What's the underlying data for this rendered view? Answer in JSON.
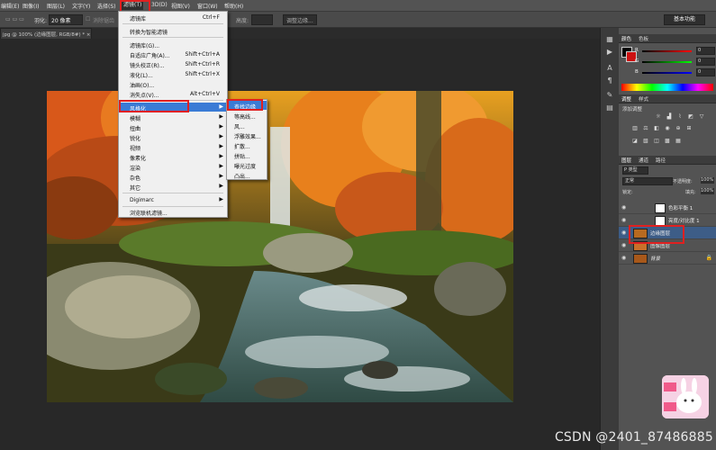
{
  "menubar": {
    "items": [
      {
        "label": "编辑(E)"
      },
      {
        "label": "图像(I)"
      },
      {
        "label": "图层(L)"
      },
      {
        "label": "文字(Y)"
      },
      {
        "label": "选择(S)"
      },
      {
        "label": "滤镜(T)"
      },
      {
        "label": "3D(D)"
      },
      {
        "label": "视图(V)"
      },
      {
        "label": "窗口(W)"
      },
      {
        "label": "帮助(H)"
      }
    ]
  },
  "options_bar": {
    "feather_label": "羽化:",
    "feather_value": "20 像素",
    "antialias_label": "消除锯齿",
    "height_label": "高度:",
    "refine_edge_button": "调整边缘...",
    "workspace_preset": "基本功能"
  },
  "document_tab": {
    "title": "jpg @ 100% (边缘图层, RGB/8#) * ×"
  },
  "filter_menu": {
    "items": [
      {
        "label": "滤镜库",
        "shortcut": "Ctrl+F"
      },
      {
        "label": "转换为智能滤镜",
        "shortcut": ""
      },
      {
        "label": "滤镜库(G)...",
        "shortcut": ""
      },
      {
        "label": "自适应广角(A)...",
        "shortcut": "Shift+Ctrl+A"
      },
      {
        "label": "镜头校正(R)...",
        "shortcut": "Shift+Ctrl+R"
      },
      {
        "label": "液化(L)...",
        "shortcut": "Shift+Ctrl+X"
      },
      {
        "label": "油画(O)...",
        "shortcut": ""
      },
      {
        "label": "消失点(V)...",
        "shortcut": "Alt+Ctrl+V"
      },
      {
        "label": "风格化",
        "shortcut": ""
      },
      {
        "label": "模糊",
        "shortcut": ""
      },
      {
        "label": "扭曲",
        "shortcut": ""
      },
      {
        "label": "锐化",
        "shortcut": ""
      },
      {
        "label": "视频",
        "shortcut": ""
      },
      {
        "label": "像素化",
        "shortcut": ""
      },
      {
        "label": "渲染",
        "shortcut": ""
      },
      {
        "label": "杂色",
        "shortcut": ""
      },
      {
        "label": "其它",
        "shortcut": ""
      },
      {
        "label": "Digimarc",
        "shortcut": ""
      },
      {
        "label": "浏览联机滤镜...",
        "shortcut": ""
      }
    ]
  },
  "stylize_submenu": {
    "items": [
      {
        "label": "查找边缘"
      },
      {
        "label": "等高线..."
      },
      {
        "label": "风..."
      },
      {
        "label": "浮雕效果..."
      },
      {
        "label": "扩散..."
      },
      {
        "label": "拼贴..."
      },
      {
        "label": "曝光过度"
      },
      {
        "label": "凸出..."
      }
    ]
  },
  "color_panel": {
    "tabs": [
      "颜色",
      "色板"
    ],
    "r_label": "R",
    "r_value": "0",
    "g_label": "G",
    "g_value": "0",
    "b_label": "B",
    "b_value": "0"
  },
  "adjust_panel": {
    "tabs": [
      "调整",
      "样式"
    ],
    "add_label": "添加调整"
  },
  "layers_panel": {
    "tabs": [
      "图层",
      "通道",
      "路径"
    ],
    "filter_kind": "P 类型",
    "blend_mode": "正常",
    "opacity_label": "不透明度:",
    "opacity_value": "100%",
    "lock_label": "锁定:",
    "fill_label": "填充:",
    "fill_value": "100%",
    "layers": [
      {
        "name": "色彩平衡 1",
        "selected": false
      },
      {
        "name": "亮度/对比度 1",
        "selected": false
      },
      {
        "name": "边缘图层",
        "selected": true
      },
      {
        "name": "图像图层",
        "selected": false
      },
      {
        "name": "背景",
        "selected": false
      }
    ]
  },
  "watermark": "CSDN @2401_87486885",
  "colors": {
    "highlight": "#3a7bd5",
    "annotation_red": "#e02020",
    "selected_layer": "#3d5d87"
  }
}
